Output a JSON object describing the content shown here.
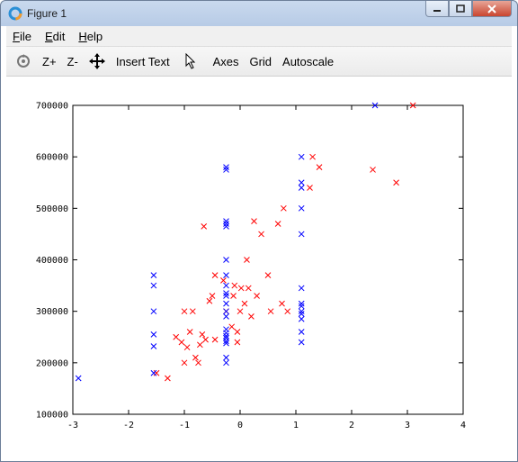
{
  "window": {
    "title": "Figure 1"
  },
  "menu": {
    "file": "File",
    "edit": "Edit",
    "help": "Help"
  },
  "toolbar": {
    "zoom_in": "Z+",
    "zoom_out": "Z-",
    "insert_text": "Insert Text",
    "axes": "Axes",
    "grid": "Grid",
    "autoscale": "Autoscale"
  },
  "colors": {
    "series_a": "#ff0000",
    "series_b": "#0000ff"
  },
  "chart_data": {
    "type": "scatter",
    "xlim": [
      -3,
      4
    ],
    "ylim": [
      100000,
      700000
    ],
    "x_ticks": [
      "-3",
      "-2",
      "-1",
      "0",
      "1",
      "2",
      "3",
      "4"
    ],
    "y_ticks": [
      "100000",
      "200000",
      "300000",
      "400000",
      "500000",
      "600000",
      "700000"
    ],
    "grid": false,
    "series": [
      {
        "color": "#ff0000",
        "marker": "x",
        "points": [
          [
            -1.5,
            180000
          ],
          [
            -1.3,
            170000
          ],
          [
            -1.15,
            250000
          ],
          [
            -1.05,
            240000
          ],
          [
            -1.0,
            300000
          ],
          [
            -1.0,
            200000
          ],
          [
            -0.95,
            230000
          ],
          [
            -0.9,
            260000
          ],
          [
            -0.85,
            300000
          ],
          [
            -0.8,
            210000
          ],
          [
            -0.75,
            200000
          ],
          [
            -0.72,
            235000
          ],
          [
            -0.68,
            255000
          ],
          [
            -0.62,
            245000
          ],
          [
            -0.65,
            465000
          ],
          [
            -0.55,
            320000
          ],
          [
            -0.5,
            330000
          ],
          [
            -0.45,
            245000
          ],
          [
            -0.45,
            370000
          ],
          [
            -0.3,
            360000
          ],
          [
            -0.25,
            300000
          ],
          [
            -0.15,
            270000
          ],
          [
            -0.12,
            330000
          ],
          [
            -0.1,
            350000
          ],
          [
            -0.05,
            260000
          ],
          [
            -0.05,
            240000
          ],
          [
            0.0,
            300000
          ],
          [
            0.02,
            345000
          ],
          [
            0.08,
            315000
          ],
          [
            0.12,
            400000
          ],
          [
            0.15,
            345000
          ],
          [
            0.2,
            290000
          ],
          [
            0.25,
            475000
          ],
          [
            0.3,
            330000
          ],
          [
            0.38,
            450000
          ],
          [
            0.5,
            370000
          ],
          [
            0.55,
            300000
          ],
          [
            0.68,
            470000
          ],
          [
            0.75,
            315000
          ],
          [
            0.78,
            500000
          ],
          [
            0.85,
            300000
          ],
          [
            1.25,
            540000
          ],
          [
            1.3,
            600000
          ],
          [
            1.42,
            580000
          ],
          [
            2.38,
            575000
          ],
          [
            2.8,
            550000
          ],
          [
            3.1,
            700000
          ]
        ]
      },
      {
        "color": "#0000ff",
        "marker": "x",
        "points": [
          [
            -2.9,
            170000
          ],
          [
            -1.55,
            370000
          ],
          [
            -1.55,
            350000
          ],
          [
            -1.55,
            300000
          ],
          [
            -1.55,
            255000
          ],
          [
            -1.55,
            232000
          ],
          [
            -1.55,
            180000
          ],
          [
            -0.25,
            580000
          ],
          [
            -0.25,
            575000
          ],
          [
            -0.25,
            475000
          ],
          [
            -0.25,
            470000
          ],
          [
            -0.25,
            465000
          ],
          [
            -0.25,
            400000
          ],
          [
            -0.25,
            370000
          ],
          [
            -0.25,
            350000
          ],
          [
            -0.25,
            335000
          ],
          [
            -0.25,
            330000
          ],
          [
            -0.25,
            315000
          ],
          [
            -0.25,
            300000
          ],
          [
            -0.25,
            290000
          ],
          [
            -0.25,
            265000
          ],
          [
            -0.25,
            258000
          ],
          [
            -0.25,
            252000
          ],
          [
            -0.25,
            248000
          ],
          [
            -0.25,
            242000
          ],
          [
            -0.25,
            238000
          ],
          [
            -0.25,
            210000
          ],
          [
            -0.25,
            200000
          ],
          [
            1.1,
            600000
          ],
          [
            1.1,
            550000
          ],
          [
            1.1,
            540000
          ],
          [
            1.1,
            500000
          ],
          [
            1.1,
            450000
          ],
          [
            1.1,
            345000
          ],
          [
            1.1,
            315000
          ],
          [
            1.1,
            310000
          ],
          [
            1.1,
            300000
          ],
          [
            1.1,
            295000
          ],
          [
            1.1,
            285000
          ],
          [
            1.1,
            260000
          ],
          [
            1.1,
            240000
          ],
          [
            2.42,
            700000
          ]
        ]
      }
    ]
  }
}
